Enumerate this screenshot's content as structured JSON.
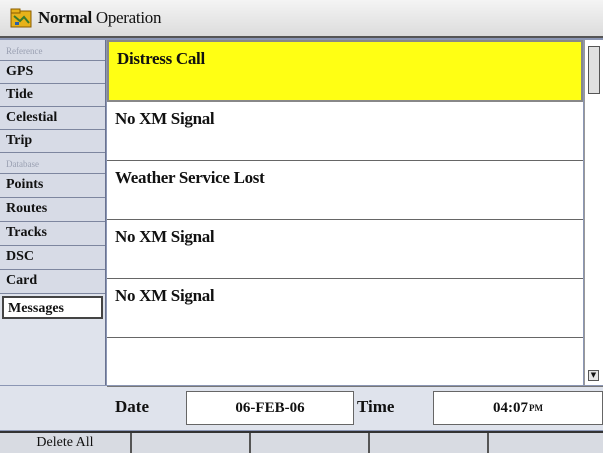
{
  "window": {
    "title_part1": "Normal",
    "title_part2": " Operation",
    "icon": "map-folder-icon"
  },
  "sidebar": {
    "items": [
      {
        "label": "Reference",
        "type": "category"
      },
      {
        "label": "GPS",
        "type": "item"
      },
      {
        "label": "Tide",
        "type": "item"
      },
      {
        "label": "Celestial",
        "type": "item"
      },
      {
        "label": "Trip",
        "type": "item"
      },
      {
        "label": "Database",
        "type": "category"
      },
      {
        "label": "Points",
        "type": "item"
      },
      {
        "label": "Routes",
        "type": "item"
      },
      {
        "label": "Tracks",
        "type": "item"
      },
      {
        "label": "DSC",
        "type": "item"
      },
      {
        "label": "Card",
        "type": "item"
      },
      {
        "label": "Messages",
        "type": "item",
        "active": true
      }
    ]
  },
  "messages": [
    {
      "text": "Distress Call",
      "selected": true
    },
    {
      "text": "No XM Signal"
    },
    {
      "text": "Weather Service Lost"
    },
    {
      "text": "No XM Signal"
    },
    {
      "text": "No XM Signal"
    }
  ],
  "details": {
    "date_label": "Date",
    "date_value": "06-FEB-06",
    "time_label": "Time",
    "time_value": "04:07",
    "time_ampm": "PM"
  },
  "softkeys": [
    "Delete All",
    "",
    "",
    "",
    ""
  ],
  "colors": {
    "selected_highlight": "#ffff14",
    "frame_blue": "#8b96b4"
  }
}
